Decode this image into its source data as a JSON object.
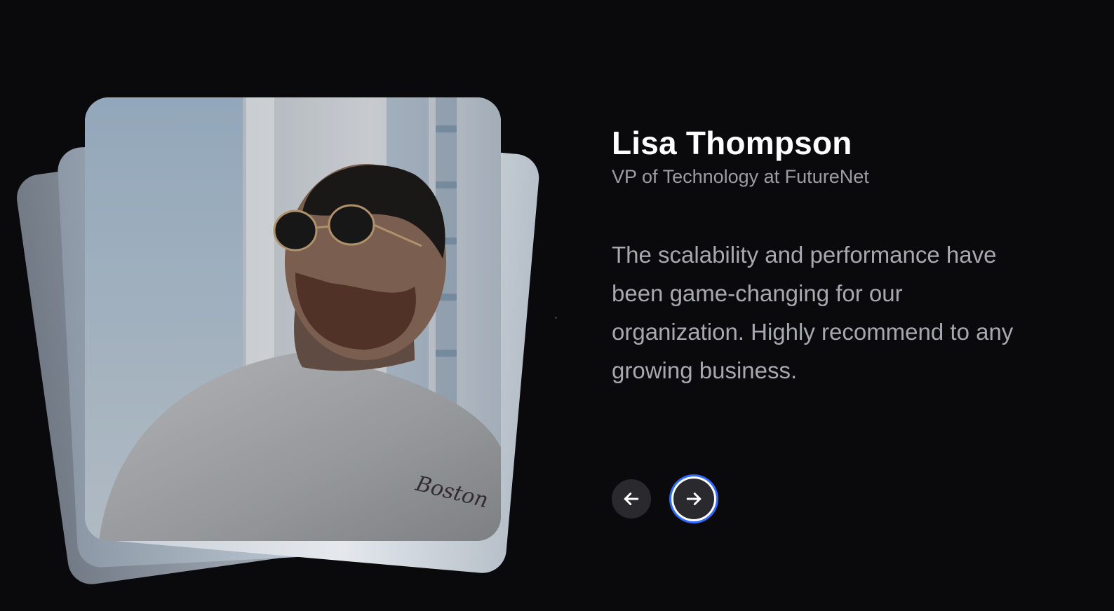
{
  "testimonial": {
    "name": "Lisa Thompson",
    "role": "VP of Technology at FutureNet",
    "quote": "The scalability and performance have been game-changing for our organization. Highly recommend to any growing business."
  },
  "controls": {
    "prev_icon": "arrow-left-icon",
    "next_icon": "arrow-right-icon",
    "focus_ring_color": "#2f6bff"
  },
  "colors": {
    "background": "#0a0a0d",
    "button_bg": "#2a2a2e"
  }
}
